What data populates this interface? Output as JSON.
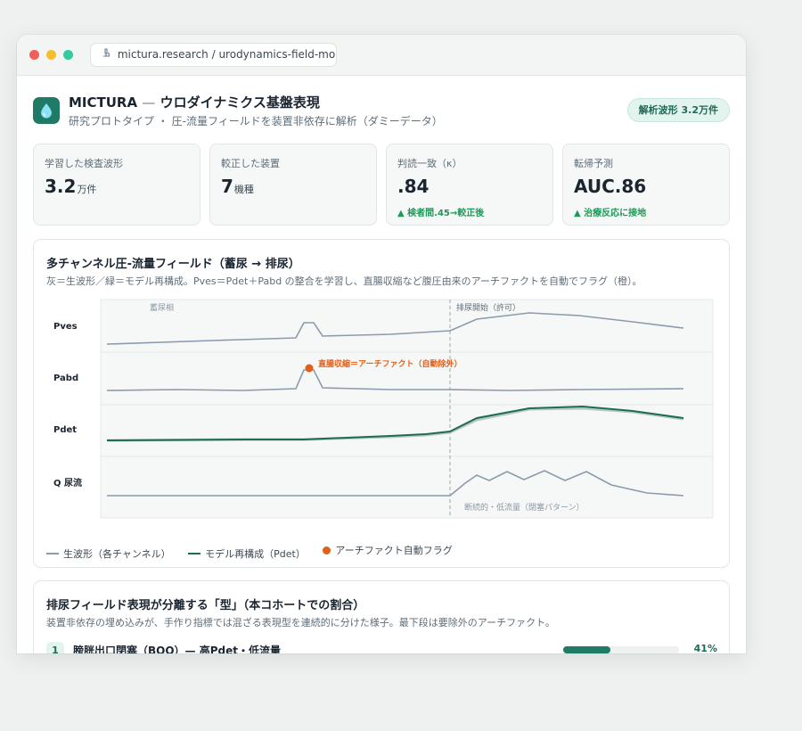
{
  "browser": {
    "url": "mictura.research / urodynamics-field-model",
    "url_icon": "microscope-icon"
  },
  "header": {
    "app_icon": "droplet-icon",
    "brand": "MICTURA",
    "separator": "—",
    "title": "ウロダイナミクス基盤表現",
    "subtitle": "研究プロトタイプ ・ 圧-流量フィールドを装置非依存に解析（ダミーデータ）",
    "badge": "解析波形 3.2万件"
  },
  "kpis": [
    {
      "label": "学習した検査波形",
      "value": "3.2",
      "unit": "万件",
      "delta": ""
    },
    {
      "label": "較正した装置",
      "value": "7",
      "unit": "機種",
      "delta": ""
    },
    {
      "label": "判読一致（κ）",
      "value": ".84",
      "unit": "",
      "delta": "▲ 検者間.45→較正後"
    },
    {
      "label": "転帰予測",
      "value": "AUC.86",
      "unit": "",
      "delta": "▲ 治療反応に接地"
    }
  ],
  "field_card": {
    "title": "多チャンネル圧-流量フィールド（蓄尿 → 排尿）",
    "description": "灰＝生波形／緑＝モデル再構成。Pves＝Pdet＋Pabd の整合を学習し、直腸収縮など腹圧由来のアーチファクトを自動でフラグ（橙）。",
    "legend": {
      "raw": "生波形（各チャンネル）",
      "model": "モデル再構成（Pdet）",
      "artifact": "アーチファクト自動フラグ"
    }
  },
  "chart_data": {
    "type": "line",
    "channels": [
      "Pves",
      "Pabd",
      "Pdet",
      "Q 尿流"
    ],
    "phase_labels": {
      "storage": "蓄尿相",
      "voiding": "排尿開始（許可）"
    },
    "annotations": {
      "artifact": "直腸収縮＝アーチファクト（自動除外）",
      "flow_pattern": "断続的・低流量（閉塞パターン）"
    },
    "grid": true,
    "colors": {
      "raw": "#8c9aac",
      "model": "#1f6b58",
      "artifact": "#e0601a"
    }
  },
  "types_card": {
    "title": "排尿フィールド表現が分離する「型」（本コホートでの割合）",
    "description": "装置非依存の埋め込みが、手作り指標では混ざる表現型を連続的に分けた様子。最下段は要除外のアーチファクト。",
    "rows": [
      {
        "num": "1",
        "label": "膀胱出口閉塞（BOO）— 高Pdet・低流量",
        "pct": "41%",
        "fraction": 0.41
      }
    ]
  }
}
